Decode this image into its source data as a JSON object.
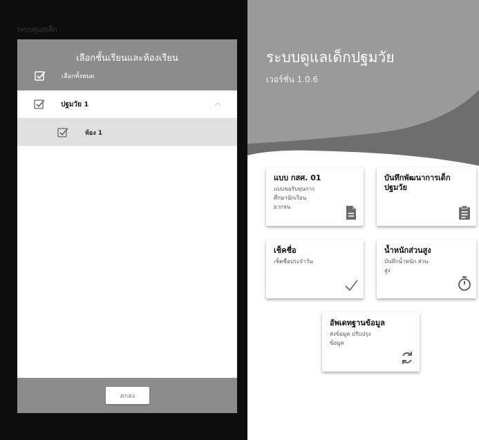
{
  "left": {
    "title": "ระบบดูแลเด็ก",
    "dialog": {
      "title": "เลือกชั้นเรียนและห้องเรียน",
      "select_all_label": "เลือกทั้งหมด",
      "levels": [
        {
          "label": "ปฐมวัย 1",
          "checked": true,
          "expanded": true,
          "rooms": [
            {
              "label": "ห้อง 1",
              "checked": true
            }
          ]
        }
      ],
      "ok_label": "ตกลง"
    }
  },
  "right": {
    "app_title": "ระบบดูแลเด็กปฐมวัย",
    "version": "เวอร์ชั่น 1.0.6",
    "cards": [
      {
        "title": "แบบ กสศ. 01",
        "desc": [
          "แบบขอรับทุนการ",
          "ศึกษานักเรียน",
          "ยากจน"
        ],
        "icon": "document-icon"
      },
      {
        "title": "บันทึกพัฒนาการเด็กปฐมวัย",
        "desc": [],
        "icon": "clipboard-icon"
      },
      {
        "title": "เช็คชื่อ",
        "desc": [
          "เช็คชื่อประจำวัน"
        ],
        "icon": "checkmark-icon"
      },
      {
        "title": "น้ำหนักส่วนสูง",
        "desc": [
          "บันทึกน้ำหนัก ส่วน",
          "สูง"
        ],
        "icon": "stopwatch-icon"
      },
      {
        "title": "อัพเดทฐานข้อมูล",
        "desc": [
          "ส่งข้อมูล ปรับปรุง",
          "ข้อมูล"
        ],
        "icon": "sync-icon"
      }
    ]
  },
  "colors": {
    "header_gray": "#8c8c8c",
    "row_selected": "#e0e0e0",
    "backdrop": "#0d0d0d",
    "blob_light": "#9a9a9a",
    "blob_dark": "#6e6e6e"
  }
}
